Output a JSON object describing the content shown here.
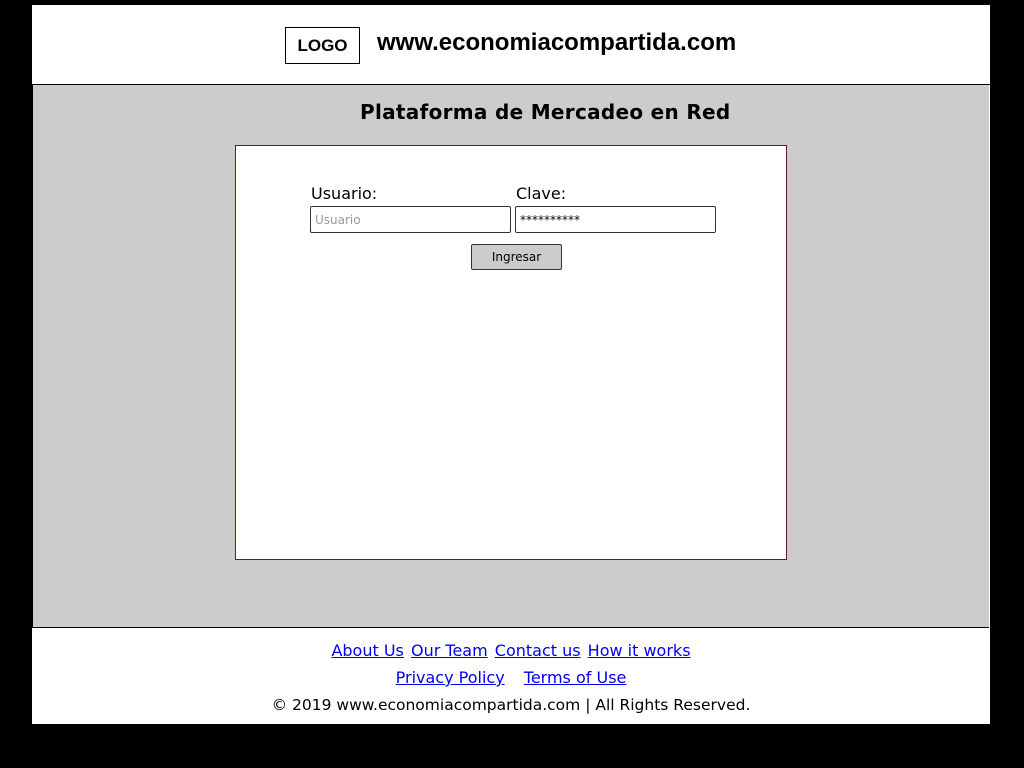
{
  "header": {
    "logo_text": "LOGO",
    "site_title": "www.economiacompartida.com"
  },
  "main": {
    "title": "Plataforma de Mercadeo en Red",
    "login": {
      "username_label": "Usuario:",
      "username_placeholder": "Usuario",
      "password_label": "Clave:",
      "password_value": "**********",
      "submit_label": "Ingresar"
    }
  },
  "footer": {
    "links_row1": [
      "About Us",
      "Our Team",
      "Contact us",
      "How it works"
    ],
    "links_row2": [
      "Privacy Policy",
      "Terms of Use"
    ],
    "copyright": "© 2019 www.economiacompartida.com | All Rights Reserved."
  },
  "colors": {
    "outer_background": "#000000",
    "main_background": "#cccccc",
    "link": "#0000ee",
    "panel_border": "#5a1a4a"
  }
}
